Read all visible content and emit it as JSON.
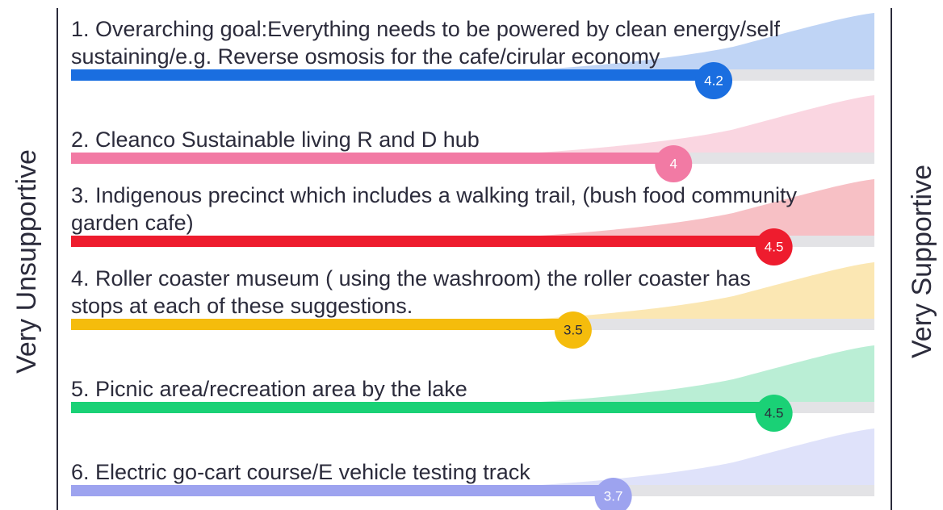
{
  "chart_data": {
    "type": "bar",
    "xlim": [
      1,
      5
    ],
    "left_label": "Very Unsupportive",
    "right_label": "Very Supportive",
    "items": [
      {
        "lines": [
          "1. Overarching goal:Everything needs to be powered by clean energy/self",
          "sustaining/e.g. Reverse osmosis for the cafe/cirular economy"
        ],
        "value": 4.2,
        "value_label": "4.2",
        "color": "#1a6ee0",
        "fill": "#b8cff4",
        "text_color": "#ffffff"
      },
      {
        "lines": [
          "2. Cleanco Sustainable living R and D hub"
        ],
        "value": 4.0,
        "value_label": "4",
        "color": "#f27aa4",
        "fill": "#f9d1de",
        "text_color": "#ffffff"
      },
      {
        "lines": [
          "3. Indigenous precinct which includes a walking trail, (bush food community",
          "garden cafe)"
        ],
        "value": 4.5,
        "value_label": "4.5",
        "color": "#ee1c2e",
        "fill": "#f6b9bf",
        "text_color": "#ffffff"
      },
      {
        "lines": [
          "4. Roller coaster museum ( using the washroom) the roller coaster has",
          "stops at each of these suggestions."
        ],
        "value": 3.5,
        "value_label": "3.5",
        "color": "#f5bc0c",
        "fill": "#fbe4ab",
        "text_color": "#2b2b3b"
      },
      {
        "lines": [
          "5. Picnic area/recreation area by the lake"
        ],
        "value": 4.5,
        "value_label": "4.5",
        "color": "#1ad176",
        "fill": "#b2ecd0",
        "text_color": "#2b2b3b"
      },
      {
        "lines": [
          "6. Electric go-cart course/E vehicle testing track"
        ],
        "value": 3.7,
        "value_label": "3.7",
        "color": "#9da3ef",
        "fill": "#dcdffa",
        "text_color": "#ffffff"
      }
    ]
  }
}
